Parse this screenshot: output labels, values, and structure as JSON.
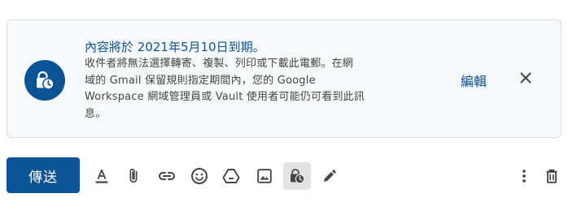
{
  "notice": {
    "title": "內容將於 2021年5月10日到期。",
    "description_lines": [
      "收件者將無法選擇轉寄、複製、列印或下載此電郵。在網",
      "域的 Gmail 保留規則指定期間內，您的 Google",
      "Workspace 網域管理員或 Vault 使用者可能仍可看到此訊",
      "息。"
    ],
    "edit_label": "編輯",
    "close_icon": "close-icon",
    "badge_icon": "confidential-clock-icon"
  },
  "toolbar": {
    "send_label": "傳送",
    "icons": [
      "text-format-icon",
      "attach-icon",
      "link-icon",
      "emoji-icon",
      "drive-icon",
      "photo-icon",
      "confidential-mode-icon",
      "signature-pen-icon",
      "more-options-icon",
      "delete-icon"
    ]
  },
  "colors": {
    "accent": "#0b5394",
    "text": "#444746",
    "icon": "#444746"
  }
}
